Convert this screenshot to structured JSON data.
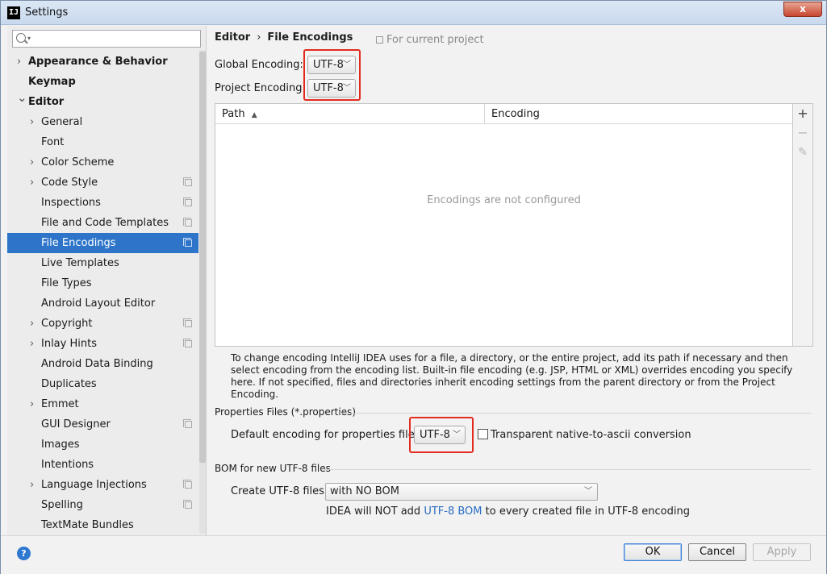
{
  "window": {
    "title": "Settings",
    "app_icon": "IJ",
    "close_label": "x"
  },
  "sidebar": {
    "search_placeholder": "",
    "items": [
      {
        "label": "Appearance & Behavior",
        "level": 0,
        "arrow": "right",
        "bold": true,
        "copy": false
      },
      {
        "label": "Keymap",
        "level": 0,
        "arrow": "",
        "bold": true,
        "copy": false
      },
      {
        "label": "Editor",
        "level": 0,
        "arrow": "down",
        "bold": true,
        "copy": false
      },
      {
        "label": "General",
        "level": 1,
        "arrow": "right",
        "bold": false,
        "copy": false
      },
      {
        "label": "Font",
        "level": 1,
        "arrow": "",
        "bold": false,
        "copy": false
      },
      {
        "label": "Color Scheme",
        "level": 1,
        "arrow": "right",
        "bold": false,
        "copy": false
      },
      {
        "label": "Code Style",
        "level": 1,
        "arrow": "right",
        "bold": false,
        "copy": true
      },
      {
        "label": "Inspections",
        "level": 1,
        "arrow": "",
        "bold": false,
        "copy": true
      },
      {
        "label": "File and Code Templates",
        "level": 1,
        "arrow": "",
        "bold": false,
        "copy": true
      },
      {
        "label": "File Encodings",
        "level": 1,
        "arrow": "",
        "bold": false,
        "copy": true,
        "selected": true
      },
      {
        "label": "Live Templates",
        "level": 1,
        "arrow": "",
        "bold": false,
        "copy": false
      },
      {
        "label": "File Types",
        "level": 1,
        "arrow": "",
        "bold": false,
        "copy": false
      },
      {
        "label": "Android Layout Editor",
        "level": 1,
        "arrow": "",
        "bold": false,
        "copy": false
      },
      {
        "label": "Copyright",
        "level": 1,
        "arrow": "right",
        "bold": false,
        "copy": true
      },
      {
        "label": "Inlay Hints",
        "level": 1,
        "arrow": "right",
        "bold": false,
        "copy": true
      },
      {
        "label": "Android Data Binding",
        "level": 1,
        "arrow": "",
        "bold": false,
        "copy": false
      },
      {
        "label": "Duplicates",
        "level": 1,
        "arrow": "",
        "bold": false,
        "copy": false
      },
      {
        "label": "Emmet",
        "level": 1,
        "arrow": "right",
        "bold": false,
        "copy": false
      },
      {
        "label": "GUI Designer",
        "level": 1,
        "arrow": "",
        "bold": false,
        "copy": true
      },
      {
        "label": "Images",
        "level": 1,
        "arrow": "",
        "bold": false,
        "copy": false
      },
      {
        "label": "Intentions",
        "level": 1,
        "arrow": "",
        "bold": false,
        "copy": false
      },
      {
        "label": "Language Injections",
        "level": 1,
        "arrow": "right",
        "bold": false,
        "copy": true
      },
      {
        "label": "Spelling",
        "level": 1,
        "arrow": "",
        "bold": false,
        "copy": true
      },
      {
        "label": "TextMate Bundles",
        "level": 1,
        "arrow": "",
        "bold": false,
        "copy": false
      }
    ]
  },
  "main": {
    "breadcrumb": {
      "parent": "Editor",
      "separator": "›",
      "current": "File Encodings"
    },
    "for_current_project": "For current project",
    "global_encoding": {
      "label": "Global Encoding:",
      "value": "UTF-8"
    },
    "project_encoding": {
      "label": "Project Encoding:",
      "value": "UTF-8"
    },
    "table": {
      "columns": [
        "Path",
        "Encoding"
      ],
      "sort_indicator": "▲",
      "empty_message": "Encodings are not configured"
    },
    "toolbar": {
      "add": "+",
      "remove": "−",
      "edit": "✎"
    },
    "help_text": "To change encoding IntelliJ IDEA uses for a file, a directory, or the entire project, add its path if necessary and then select encoding from the encoding list. Built-in file encoding (e.g. JSP, HTML or XML) overrides encoding you specify here. If not specified, files and directories inherit encoding settings from the parent directory or from the Project Encoding.",
    "properties": {
      "section_title": "Properties Files (*.properties)",
      "default_label": "Default encoding for properties files:",
      "default_value": "UTF-8",
      "transparent_label": "Transparent native-to-ascii conversion",
      "transparent_checked": false
    },
    "bom": {
      "section_title": "BOM for new UTF-8 files",
      "create_label": "Create UTF-8 files:",
      "create_value": "with NO BOM",
      "note_prefix": "IDEA will NOT add ",
      "note_link": "UTF-8 BOM",
      "note_suffix": " to every created file in UTF-8 encoding"
    }
  },
  "footer": {
    "help": "?",
    "ok": "OK",
    "cancel": "Cancel",
    "apply": "Apply"
  },
  "colors": {
    "selection": "#2e75c9",
    "highlight": "#e32a1f",
    "link": "#2a6cc4"
  }
}
